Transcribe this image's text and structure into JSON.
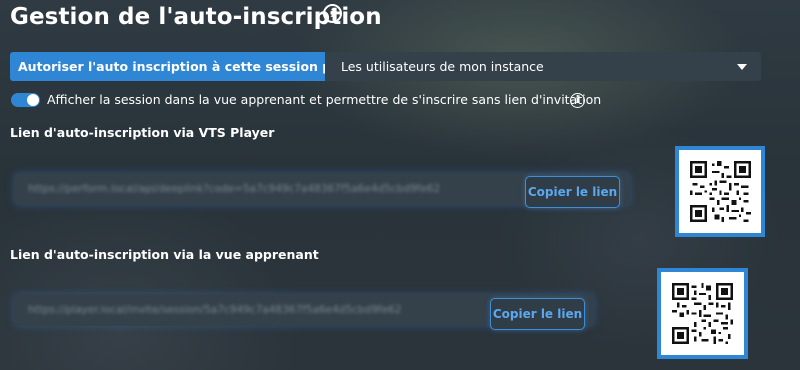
{
  "header": {
    "title": "Gestion de l'auto-inscription",
    "info_glyph": "i"
  },
  "self_registration": {
    "label": "Autoriser l'auto inscription à cette session pour :",
    "selected_value": "Les utilisateurs de mon instance"
  },
  "visibility_toggle": {
    "enabled": true,
    "label": "Afficher la session dans la vue apprenant et permettre de s'inscrire sans lien d'invitation",
    "info_glyph": "i"
  },
  "vts_player_link": {
    "title": "Lien d'auto-inscription via VTS Player",
    "url": "https://perform.local/api/deeplink?code=5a7c949c7a48367f5a6e4d5cbd9fe62",
    "copy_label": "Copier le lien"
  },
  "learner_view_link": {
    "title": "Lien d'auto-inscription via la vue apprenant",
    "url": "https://player.local/invite/session/5a7c949c7a48367f5a6e4d5cbd9fe62",
    "copy_label": "Copier le lien"
  },
  "colors": {
    "accent": "#2f86d4",
    "button_text": "#5aa8ee",
    "panel": "#34404a"
  }
}
